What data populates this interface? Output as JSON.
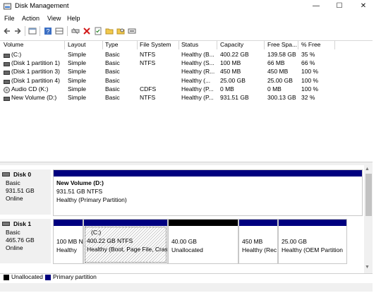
{
  "window": {
    "title": "Disk Management",
    "minimize": "—",
    "maximize": "☐",
    "close": "✕"
  },
  "menu": [
    "File",
    "Action",
    "View",
    "Help"
  ],
  "toolbar_icons": [
    "back-arrow-icon",
    "forward-arrow-icon",
    "properties-icon",
    "help-icon",
    "panel-icon",
    "connect-icon",
    "delete-icon",
    "checklist-icon",
    "folder-icon",
    "drive-icon"
  ],
  "columns": [
    "Volume",
    "Layout",
    "Type",
    "File System",
    "Status",
    "Capacity",
    "Free Spa...",
    "% Free"
  ],
  "volumes": [
    {
      "volume": "(C:)",
      "layout": "Simple",
      "type": "Basic",
      "fs": "NTFS",
      "status": "Healthy (B...",
      "capacity": "400.22 GB",
      "free": "139.58 GB",
      "pct": "35 %",
      "icon": "drive-icon"
    },
    {
      "volume": "(Disk 1 partition 1)",
      "layout": "Simple",
      "type": "Basic",
      "fs": "NTFS",
      "status": "Healthy (S...",
      "capacity": "100 MB",
      "free": "66 MB",
      "pct": "66 %",
      "icon": "drive-icon"
    },
    {
      "volume": "(Disk 1 partition 3)",
      "layout": "Simple",
      "type": "Basic",
      "fs": "",
      "status": "Healthy (R...",
      "capacity": "450 MB",
      "free": "450 MB",
      "pct": "100 %",
      "icon": "drive-icon"
    },
    {
      "volume": "(Disk 1 partition 4)",
      "layout": "Simple",
      "type": "Basic",
      "fs": "",
      "status": "Healthy (...",
      "capacity": "25.00 GB",
      "free": "25.00 GB",
      "pct": "100 %",
      "icon": "drive-icon"
    },
    {
      "volume": "Audio CD (K:)",
      "layout": "Simple",
      "type": "Basic",
      "fs": "CDFS",
      "status": "Healthy (P...",
      "capacity": "0 MB",
      "free": "0 MB",
      "pct": "100 %",
      "icon": "cd-icon"
    },
    {
      "volume": "New Volume (D:)",
      "layout": "Simple",
      "type": "Basic",
      "fs": "NTFS",
      "status": "Healthy (P...",
      "capacity": "931.51 GB",
      "free": "300.13 GB",
      "pct": "32 %",
      "icon": "drive-icon"
    }
  ],
  "disks": [
    {
      "name": "Disk 0",
      "type": "Basic",
      "size": "931.51 GB",
      "state": "Online",
      "partitions": [
        {
          "title": "New Volume  (D:)",
          "line1": "931.51 GB NTFS",
          "line2": "Healthy (Primary Partition)",
          "kind": "primary"
        }
      ]
    },
    {
      "name": "Disk 1",
      "type": "Basic",
      "size": "465.76 GB",
      "state": "Online",
      "partitions": [
        {
          "title": "",
          "line1": "100 MB N",
          "line2": "Healthy",
          "kind": "primary"
        },
        {
          "title": "(C:)",
          "line1": "400.22 GB NTFS",
          "line2": "Healthy (Boot, Page File, Cras",
          "kind": "primary-selected"
        },
        {
          "title": "",
          "line1": "40.00 GB",
          "line2": "Unallocated",
          "kind": "unallocated"
        },
        {
          "title": "",
          "line1": "450 MB",
          "line2": "Healthy (Rec",
          "kind": "primary"
        },
        {
          "title": "",
          "line1": "25.00 GB",
          "line2": "Healthy (OEM Partition",
          "kind": "primary"
        }
      ]
    }
  ],
  "legend": [
    {
      "label": "Unallocated",
      "color": "#000000"
    },
    {
      "label": "Primary partition",
      "color": "#00007f"
    }
  ],
  "colors": {
    "primary": "#00007f",
    "unallocated": "#000000",
    "selection_hatch": "#cfcfcf"
  }
}
